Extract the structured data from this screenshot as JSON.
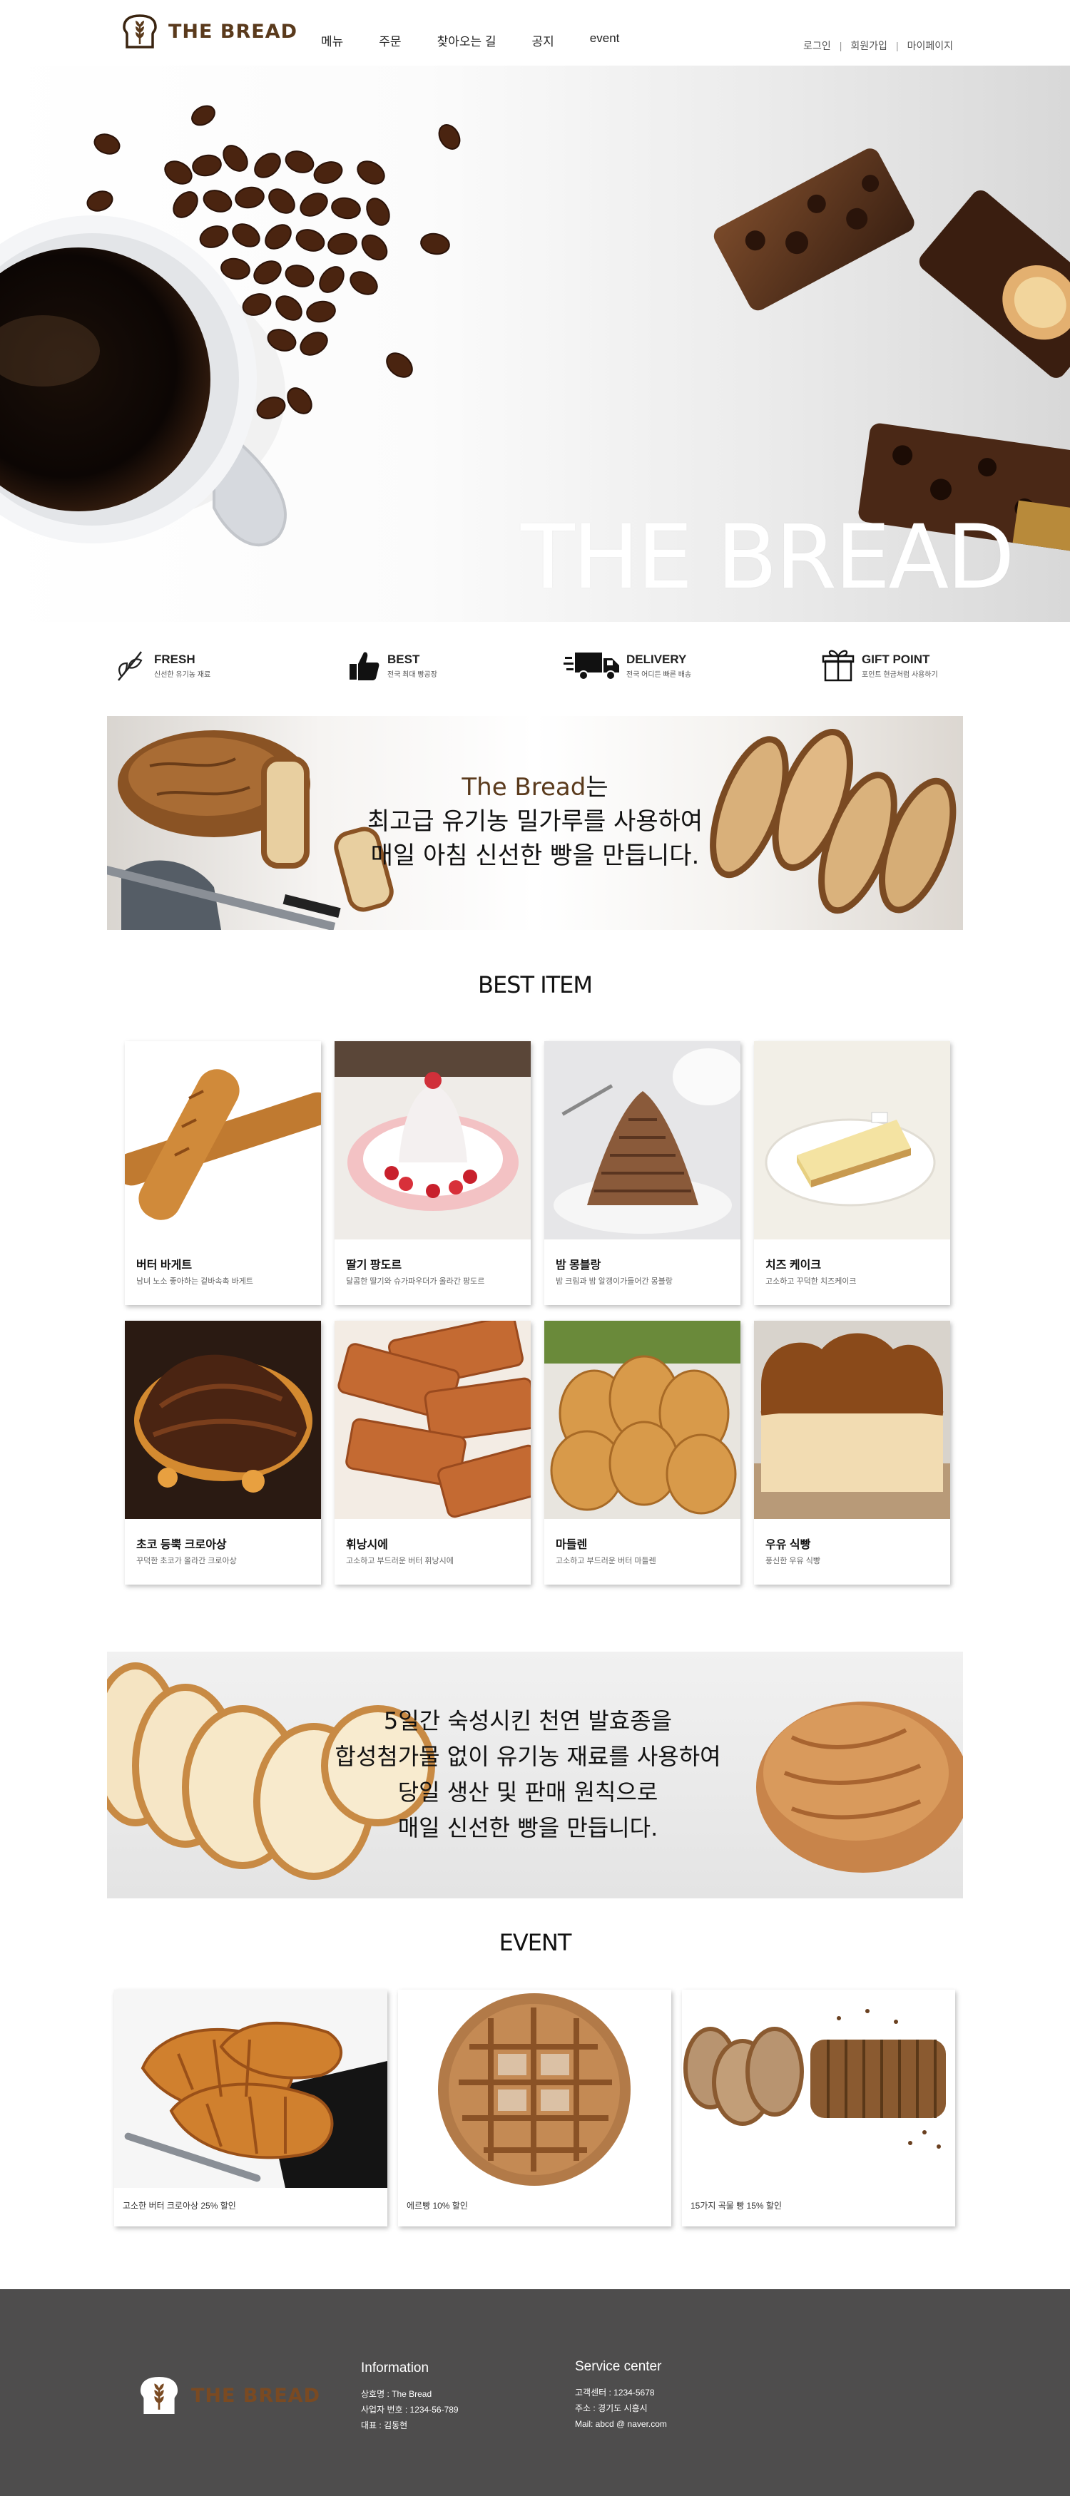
{
  "header": {
    "logo_text": "THE BREAD",
    "nav": [
      "메뉴",
      "주문",
      "찾아오는 길",
      "공지",
      "event"
    ],
    "util": [
      "로그인",
      "회원가입",
      "마이페이지"
    ]
  },
  "hero": {
    "title": "THE BREAD"
  },
  "features": [
    {
      "title": "FRESH",
      "subtitle": "신선한 유기농 재료",
      "icon": "wheat-icon"
    },
    {
      "title": "BEST",
      "subtitle": "전국 최대 빵공장",
      "icon": "thumbs-up-icon"
    },
    {
      "title": "DELIVERY",
      "subtitle": "전국 어디든 빠른 배송",
      "icon": "truck-icon"
    },
    {
      "title": "GIFT POINT",
      "subtitle": "포인트 현금처럼 사용하기",
      "icon": "gift-icon"
    }
  ],
  "intro_banner": {
    "brand": "The Bread",
    "brand_suffix": "는",
    "line2": "최고급 유기농 밀가루를 사용하여",
    "line3": "매일 아침 신선한 빵을 만듭니다."
  },
  "best": {
    "title": "BEST ITEM",
    "items": [
      {
        "name": "버터 바게트",
        "desc": "남녀 노소 좋아하는 겉바속촉 바게트"
      },
      {
        "name": "딸기 팡도르",
        "desc": "달콤한 딸기와 슈가파우더가 올라간 팡도르"
      },
      {
        "name": "밤 몽블랑",
        "desc": "밤 크림과 밤 알갱이가들어간 몽블랑"
      },
      {
        "name": "치즈 케이크",
        "desc": "고소하고 꾸덕한 치즈케이크"
      },
      {
        "name": "초코 등뿍 크로아상",
        "desc": "꾸덕한 초코가 올라간 크로아상"
      },
      {
        "name": "휘낭시에",
        "desc": "고소하고 부드러운 버터 휘낭시에"
      },
      {
        "name": "마들렌",
        "desc": "고소하고 부드러운 버터 마들렌"
      },
      {
        "name": "우유 식빵",
        "desc": "풍신한 우유 식빵"
      }
    ]
  },
  "second_banner": {
    "lines": [
      "5일간 숙성시킨 천연 발효종을",
      "합성첨가물 없이 유기농 재료를 사용하여",
      "당일 생산 및 판매 원칙으로",
      "매일 신선한 빵을 만듭니다."
    ]
  },
  "event": {
    "title": "EVENT",
    "items": [
      {
        "text": "고소한 버터 크로아상 25% 할인"
      },
      {
        "text": "에르빵 10% 할인"
      },
      {
        "text": "15가지 곡물 빵 15% 할인"
      }
    ]
  },
  "footer": {
    "logo_text": "THE BREAD",
    "info": {
      "title": "Information",
      "lines": [
        "상호명 : The Bread",
        "사업자 번호 : 1234-56-789",
        "대표 : 김동현"
      ]
    },
    "service": {
      "title": "Service center",
      "lines": [
        "고객센터 : 1234-5678",
        "주소 : 경기도 시흥시",
        "Mail: abcd @ naver.com"
      ]
    }
  },
  "colors": {
    "brand_brown": "#5a3a1c",
    "footer_bg": "#4e4d4d"
  }
}
